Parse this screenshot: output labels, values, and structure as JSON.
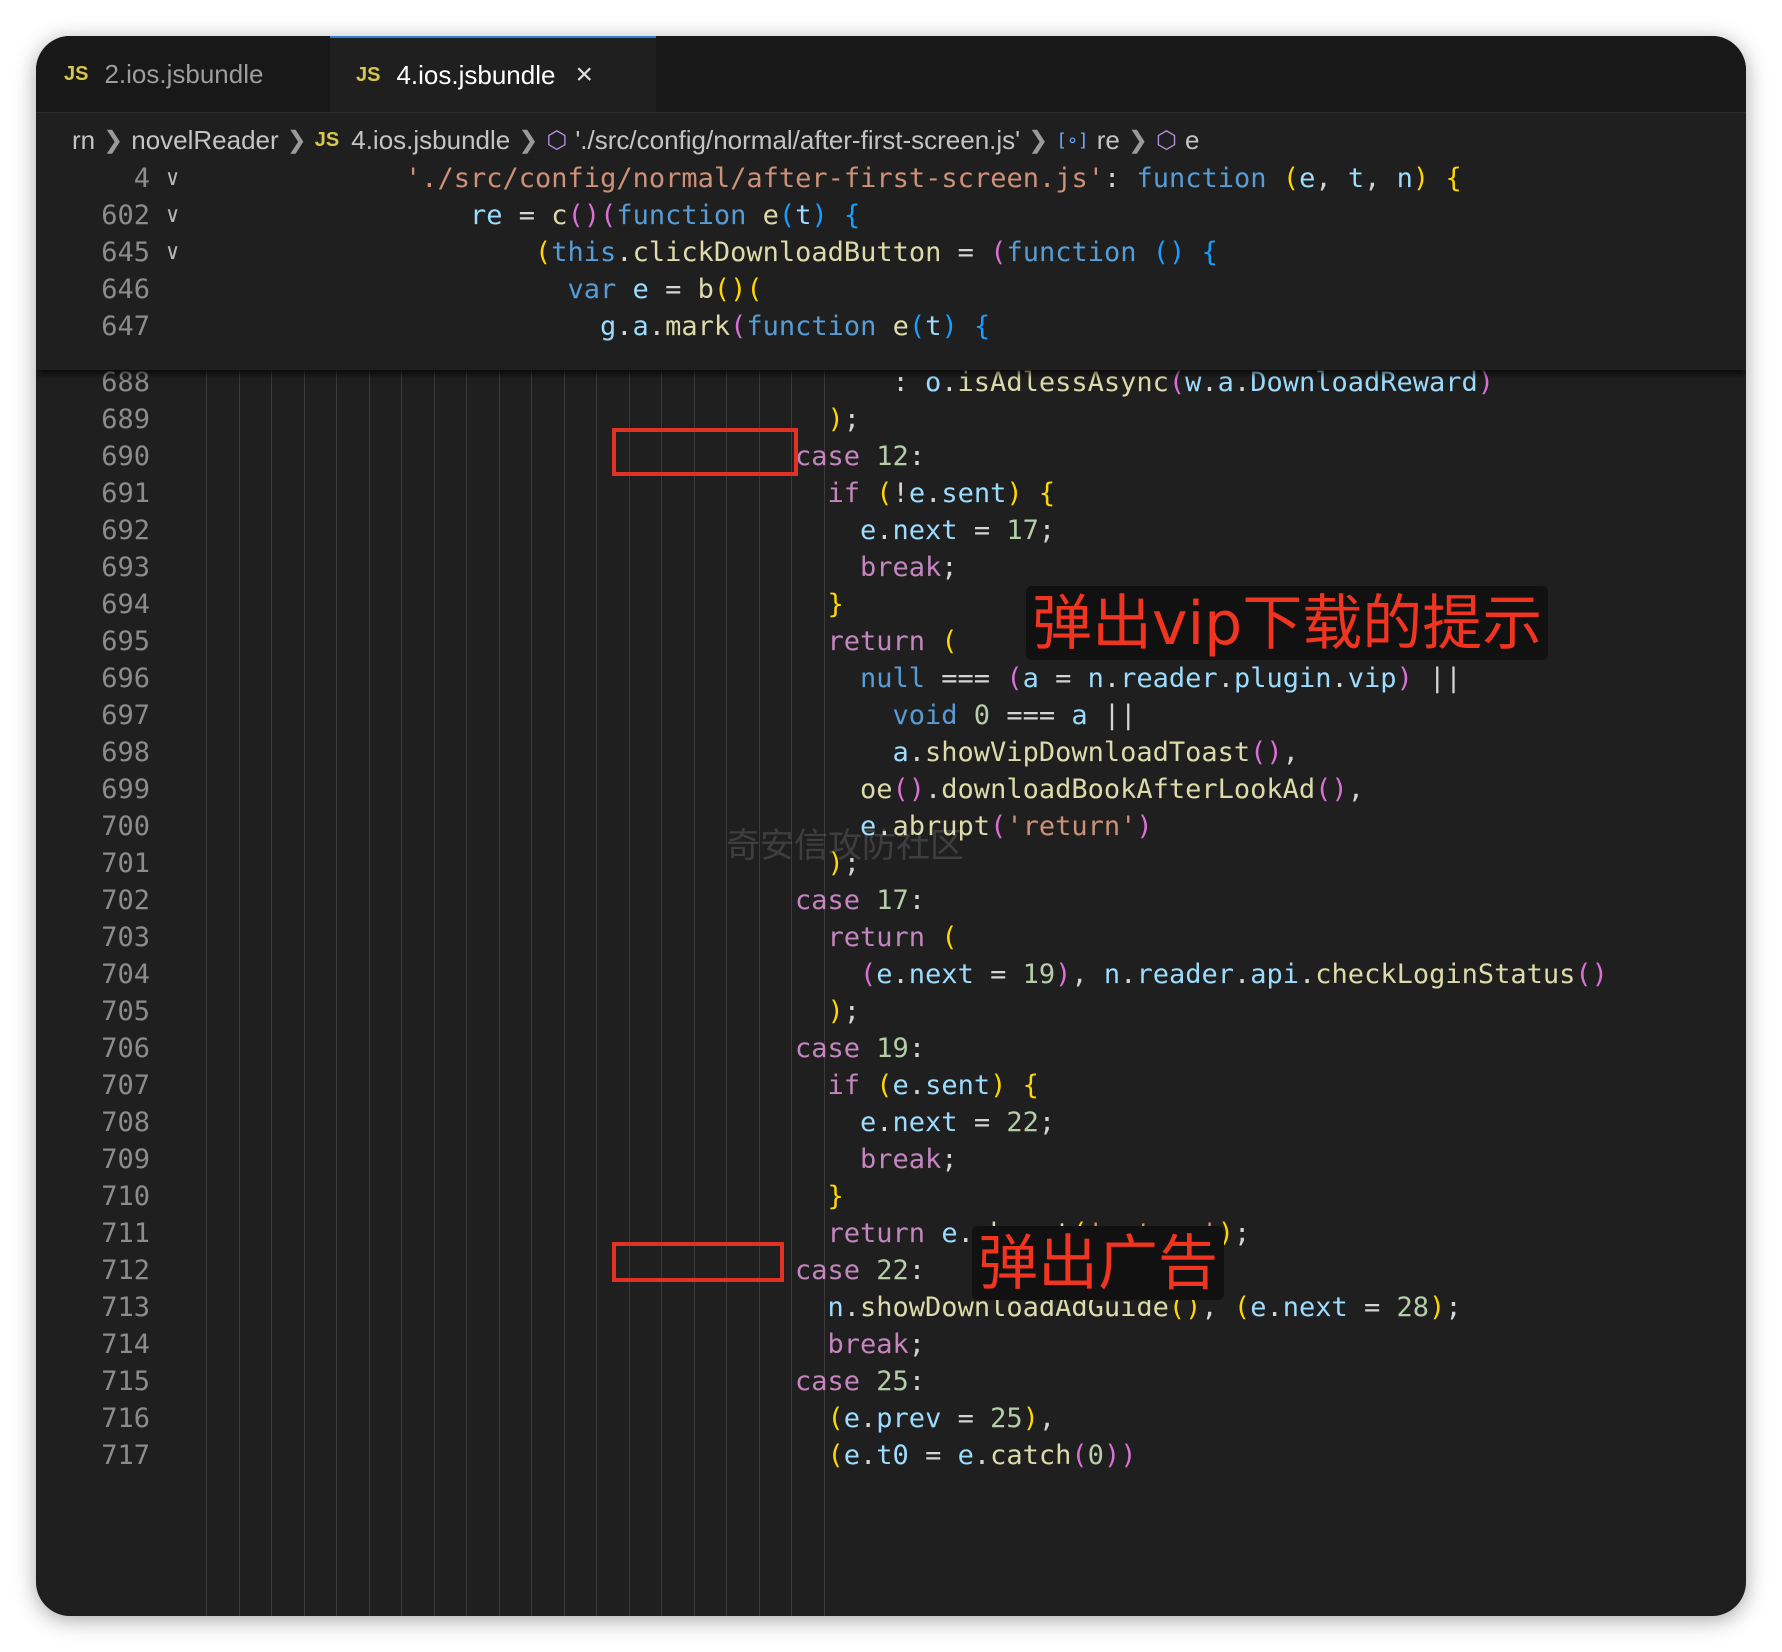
{
  "tabs": [
    {
      "icon": "JS",
      "label": "2.ios.jsbundle"
    },
    {
      "icon": "JS",
      "label": "4.ios.jsbundle",
      "close": "×"
    }
  ],
  "breadcrumb": [
    {
      "label": "rn"
    },
    {
      "label": "novelReader"
    },
    {
      "icon": "JS",
      "label": "4.ios.jsbundle"
    },
    {
      "label": "'./src/config/normal/after-first-screen.js'"
    },
    {
      "label": "re"
    },
    {
      "label": "e"
    }
  ],
  "sticky_lines": [
    {
      "n": "4",
      "indent": 6,
      "toks": [
        [
          "s",
          "'./src/config/normal/after-first-screen.js'"
        ],
        [
          "p",
          ": "
        ],
        [
          "k",
          "function"
        ],
        [
          "p",
          " "
        ],
        [
          "b1",
          "("
        ],
        [
          "v",
          "e"
        ],
        [
          "p",
          ", "
        ],
        [
          "v",
          "t"
        ],
        [
          "p",
          ", "
        ],
        [
          "v",
          "n"
        ],
        [
          "b1",
          ")"
        ],
        [
          "p",
          " "
        ],
        [
          "b1",
          "{"
        ]
      ]
    },
    {
      "n": "602",
      "indent": 8,
      "toks": [
        [
          "v",
          "re"
        ],
        [
          "p",
          " = "
        ],
        [
          "f",
          "c"
        ],
        [
          "b2",
          "()"
        ],
        [
          "b2",
          "("
        ],
        [
          "k",
          "function"
        ],
        [
          "p",
          " "
        ],
        [
          "f",
          "e"
        ],
        [
          "b3",
          "("
        ],
        [
          "v",
          "t"
        ],
        [
          "b3",
          ")"
        ],
        [
          "p",
          " "
        ],
        [
          "b3",
          "{"
        ]
      ]
    },
    {
      "n": "645",
      "indent": 10,
      "toks": [
        [
          "b1",
          "("
        ],
        [
          "k",
          "this"
        ],
        [
          "p",
          "."
        ],
        [
          "f",
          "clickDownloadButton"
        ],
        [
          "p",
          " = "
        ],
        [
          "b2",
          "("
        ],
        [
          "k",
          "function"
        ],
        [
          "p",
          " "
        ],
        [
          "b3",
          "()"
        ],
        [
          "p",
          " "
        ],
        [
          "b3",
          "{"
        ]
      ]
    },
    {
      "n": "646",
      "indent": 11,
      "toks": [
        [
          "k",
          "var"
        ],
        [
          "p",
          " "
        ],
        [
          "v",
          "e"
        ],
        [
          "p",
          " = "
        ],
        [
          "f",
          "b"
        ],
        [
          "b1",
          "()"
        ],
        [
          "b1",
          "("
        ]
      ]
    },
    {
      "n": "647",
      "indent": 12,
      "toks": [
        [
          "v",
          "g"
        ],
        [
          "p",
          "."
        ],
        [
          "v",
          "a"
        ],
        [
          "p",
          "."
        ],
        [
          "f",
          "mark"
        ],
        [
          "b2",
          "("
        ],
        [
          "k",
          "function"
        ],
        [
          "p",
          " "
        ],
        [
          "f",
          "e"
        ],
        [
          "b3",
          "("
        ],
        [
          "v",
          "t"
        ],
        [
          "b3",
          ")"
        ],
        [
          "p",
          " "
        ],
        [
          "b3",
          "{"
        ]
      ]
    }
  ],
  "code_lines": [
    {
      "n": "688",
      "indent": 21,
      "toks": [
        [
          "p",
          ": "
        ],
        [
          "v",
          "o"
        ],
        [
          "p",
          "."
        ],
        [
          "f",
          "isAdlessAsync"
        ],
        [
          "b2",
          "("
        ],
        [
          "v",
          "w"
        ],
        [
          "p",
          "."
        ],
        [
          "v",
          "a"
        ],
        [
          "p",
          "."
        ],
        [
          "v",
          "DownloadReward"
        ],
        [
          "b2",
          ")"
        ]
      ]
    },
    {
      "n": "689",
      "indent": 19,
      "toks": [
        [
          "b1",
          ")"
        ],
        [
          "p",
          ";"
        ]
      ]
    },
    {
      "n": "690",
      "indent": 18,
      "toks": [
        [
          "kw",
          "case"
        ],
        [
          "p",
          " "
        ],
        [
          "n",
          "12"
        ],
        [
          "p",
          ":"
        ]
      ]
    },
    {
      "n": "691",
      "indent": 19,
      "toks": [
        [
          "kw",
          "if"
        ],
        [
          "p",
          " "
        ],
        [
          "b1",
          "("
        ],
        [
          "p",
          "!"
        ],
        [
          "v",
          "e"
        ],
        [
          "p",
          "."
        ],
        [
          "v",
          "sent"
        ],
        [
          "b1",
          ")"
        ],
        [
          "p",
          " "
        ],
        [
          "b1",
          "{"
        ]
      ]
    },
    {
      "n": "692",
      "indent": 20,
      "toks": [
        [
          "v",
          "e"
        ],
        [
          "p",
          "."
        ],
        [
          "v",
          "next"
        ],
        [
          "p",
          " = "
        ],
        [
          "n",
          "17"
        ],
        [
          "p",
          ";"
        ]
      ]
    },
    {
      "n": "693",
      "indent": 20,
      "toks": [
        [
          "kw",
          "break"
        ],
        [
          "p",
          ";"
        ]
      ]
    },
    {
      "n": "694",
      "indent": 19,
      "toks": [
        [
          "b1",
          "}"
        ]
      ]
    },
    {
      "n": "695",
      "indent": 19,
      "toks": [
        [
          "kw",
          "return"
        ],
        [
          "p",
          " "
        ],
        [
          "b1",
          "("
        ]
      ]
    },
    {
      "n": "696",
      "indent": 20,
      "toks": [
        [
          "k",
          "null"
        ],
        [
          "p",
          " === "
        ],
        [
          "b2",
          "("
        ],
        [
          "v",
          "a"
        ],
        [
          "p",
          " = "
        ],
        [
          "v",
          "n"
        ],
        [
          "p",
          "."
        ],
        [
          "v",
          "reader"
        ],
        [
          "p",
          "."
        ],
        [
          "v",
          "plugin"
        ],
        [
          "p",
          "."
        ],
        [
          "v",
          "vip"
        ],
        [
          "b2",
          ")"
        ],
        [
          "p",
          " ||"
        ]
      ]
    },
    {
      "n": "697",
      "indent": 21,
      "toks": [
        [
          "k",
          "void"
        ],
        [
          "p",
          " "
        ],
        [
          "n",
          "0"
        ],
        [
          "p",
          " === "
        ],
        [
          "v",
          "a"
        ],
        [
          "p",
          " ||"
        ]
      ]
    },
    {
      "n": "698",
      "indent": 21,
      "toks": [
        [
          "v",
          "a"
        ],
        [
          "p",
          "."
        ],
        [
          "f",
          "showVipDownloadToast"
        ],
        [
          "b2",
          "()"
        ],
        [
          "p",
          ","
        ]
      ]
    },
    {
      "n": "699",
      "indent": 20,
      "toks": [
        [
          "f",
          "oe"
        ],
        [
          "b2",
          "()"
        ],
        [
          "p",
          "."
        ],
        [
          "f",
          "downloadBookAfterLookAd"
        ],
        [
          "b2",
          "()"
        ],
        [
          "p",
          ","
        ]
      ]
    },
    {
      "n": "700",
      "indent": 20,
      "toks": [
        [
          "v",
          "e"
        ],
        [
          "p",
          "."
        ],
        [
          "f",
          "abrupt"
        ],
        [
          "b2",
          "("
        ],
        [
          "s",
          "'return'"
        ],
        [
          "b2",
          ")"
        ]
      ]
    },
    {
      "n": "701",
      "indent": 19,
      "toks": [
        [
          "b1",
          ")"
        ],
        [
          "p",
          ";"
        ]
      ]
    },
    {
      "n": "702",
      "indent": 18,
      "toks": [
        [
          "kw",
          "case"
        ],
        [
          "p",
          " "
        ],
        [
          "n",
          "17"
        ],
        [
          "p",
          ":"
        ]
      ]
    },
    {
      "n": "703",
      "indent": 19,
      "toks": [
        [
          "kw",
          "return"
        ],
        [
          "p",
          " "
        ],
        [
          "b1",
          "("
        ]
      ]
    },
    {
      "n": "704",
      "indent": 20,
      "toks": [
        [
          "b2",
          "("
        ],
        [
          "v",
          "e"
        ],
        [
          "p",
          "."
        ],
        [
          "v",
          "next"
        ],
        [
          "p",
          " = "
        ],
        [
          "n",
          "19"
        ],
        [
          "b2",
          ")"
        ],
        [
          "p",
          ", "
        ],
        [
          "v",
          "n"
        ],
        [
          "p",
          "."
        ],
        [
          "v",
          "reader"
        ],
        [
          "p",
          "."
        ],
        [
          "v",
          "api"
        ],
        [
          "p",
          "."
        ],
        [
          "f",
          "checkLoginStatus"
        ],
        [
          "b2",
          "()"
        ]
      ]
    },
    {
      "n": "705",
      "indent": 19,
      "toks": [
        [
          "b1",
          ")"
        ],
        [
          "p",
          ";"
        ]
      ]
    },
    {
      "n": "706",
      "indent": 18,
      "toks": [
        [
          "kw",
          "case"
        ],
        [
          "p",
          " "
        ],
        [
          "n",
          "19"
        ],
        [
          "p",
          ":"
        ]
      ]
    },
    {
      "n": "707",
      "indent": 19,
      "toks": [
        [
          "kw",
          "if"
        ],
        [
          "p",
          " "
        ],
        [
          "b1",
          "("
        ],
        [
          "v",
          "e"
        ],
        [
          "p",
          "."
        ],
        [
          "v",
          "sent"
        ],
        [
          "b1",
          ")"
        ],
        [
          "p",
          " "
        ],
        [
          "b1",
          "{"
        ]
      ]
    },
    {
      "n": "708",
      "indent": 20,
      "toks": [
        [
          "v",
          "e"
        ],
        [
          "p",
          "."
        ],
        [
          "v",
          "next"
        ],
        [
          "p",
          " = "
        ],
        [
          "n",
          "22"
        ],
        [
          "p",
          ";"
        ]
      ]
    },
    {
      "n": "709",
      "indent": 20,
      "toks": [
        [
          "kw",
          "break"
        ],
        [
          "p",
          ";"
        ]
      ]
    },
    {
      "n": "710",
      "indent": 19,
      "toks": [
        [
          "b1",
          "}"
        ]
      ]
    },
    {
      "n": "711",
      "indent": 19,
      "toks": [
        [
          "kw",
          "return"
        ],
        [
          "p",
          " "
        ],
        [
          "v",
          "e"
        ],
        [
          "p",
          "."
        ],
        [
          "f",
          "abrupt"
        ],
        [
          "b1",
          "("
        ],
        [
          "s",
          "'return'"
        ],
        [
          "b1",
          ")"
        ],
        [
          "p",
          ";"
        ]
      ]
    },
    {
      "n": "712",
      "indent": 18,
      "toks": [
        [
          "kw",
          "case"
        ],
        [
          "p",
          " "
        ],
        [
          "n",
          "22"
        ],
        [
          "p",
          ":"
        ]
      ]
    },
    {
      "n": "713",
      "indent": 19,
      "toks": [
        [
          "v",
          "n"
        ],
        [
          "p",
          "."
        ],
        [
          "f",
          "showDownloadAdGuide"
        ],
        [
          "b1",
          "()"
        ],
        [
          "p",
          ", "
        ],
        [
          "b1",
          "("
        ],
        [
          "v",
          "e"
        ],
        [
          "p",
          "."
        ],
        [
          "v",
          "next"
        ],
        [
          "p",
          " = "
        ],
        [
          "n",
          "28"
        ],
        [
          "b1",
          ")"
        ],
        [
          "p",
          ";"
        ]
      ]
    },
    {
      "n": "714",
      "indent": 19,
      "toks": [
        [
          "kw",
          "break"
        ],
        [
          "p",
          ";"
        ]
      ]
    },
    {
      "n": "715",
      "indent": 18,
      "toks": [
        [
          "kw",
          "case"
        ],
        [
          "p",
          " "
        ],
        [
          "n",
          "25"
        ],
        [
          "p",
          ":"
        ]
      ]
    },
    {
      "n": "716",
      "indent": 19,
      "toks": [
        [
          "b1",
          "("
        ],
        [
          "v",
          "e"
        ],
        [
          "p",
          "."
        ],
        [
          "v",
          "prev"
        ],
        [
          "p",
          " = "
        ],
        [
          "n",
          "25"
        ],
        [
          "b1",
          ")"
        ],
        [
          "p",
          ","
        ]
      ]
    },
    {
      "n": "717",
      "indent": 19,
      "toks": [
        [
          "b1",
          "("
        ],
        [
          "v",
          "e"
        ],
        [
          "p",
          "."
        ],
        [
          "v",
          "t0"
        ],
        [
          "p",
          " = "
        ],
        [
          "v",
          "e"
        ],
        [
          "p",
          "."
        ],
        [
          "f",
          "catch"
        ],
        [
          "b2",
          "("
        ],
        [
          "n",
          "0"
        ],
        [
          "b2",
          "))"
        ]
      ]
    }
  ],
  "annotations": {
    "vip_toast_note": "弹出vip下载的提示",
    "ad_note": "弹出广告"
  },
  "watermark": "奇安信攻防社区",
  "colors": {
    "editor_bg": "#1f1f1f",
    "tabbar_bg": "#181818",
    "highlight_box": "#e03124",
    "note_text": "#f0341f",
    "note_bg": "#111111"
  }
}
